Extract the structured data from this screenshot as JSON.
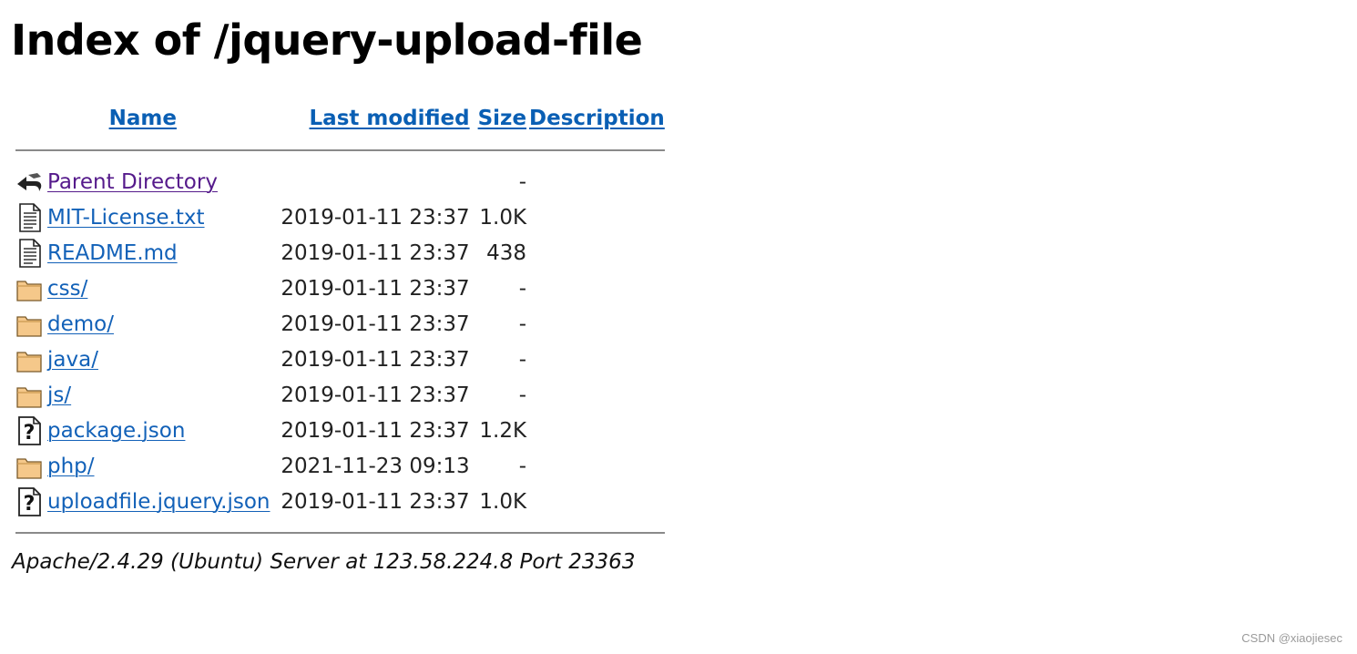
{
  "page": {
    "title": "Index of /jquery-upload-file"
  },
  "table": {
    "headers": {
      "name": "Name",
      "last_modified": "Last modified",
      "size": "Size",
      "description": "Description"
    },
    "rows": [
      {
        "icon": "back-icon",
        "name": "Parent Directory",
        "modified": "",
        "size": "-",
        "visited": true
      },
      {
        "icon": "text-file-icon",
        "name": "MIT-License.txt",
        "modified": "2019-01-11 23:37",
        "size": "1.0K"
      },
      {
        "icon": "text-file-icon",
        "name": "README.md",
        "modified": "2019-01-11 23:37",
        "size": "438"
      },
      {
        "icon": "folder-icon",
        "name": "css/",
        "modified": "2019-01-11 23:37",
        "size": "-"
      },
      {
        "icon": "folder-icon",
        "name": "demo/",
        "modified": "2019-01-11 23:37",
        "size": "-"
      },
      {
        "icon": "folder-icon",
        "name": "java/",
        "modified": "2019-01-11 23:37",
        "size": "-"
      },
      {
        "icon": "folder-icon",
        "name": "js/",
        "modified": "2019-01-11 23:37",
        "size": "-"
      },
      {
        "icon": "unknown-file-icon",
        "name": "package.json",
        "modified": "2019-01-11 23:37",
        "size": "1.2K"
      },
      {
        "icon": "folder-icon",
        "name": "php/",
        "modified": "2021-11-23 09:13",
        "size": "-"
      },
      {
        "icon": "unknown-file-icon",
        "name": "uploadfile.jquery.json",
        "modified": "2019-01-11 23:37",
        "size": "1.0K"
      }
    ]
  },
  "footer": {
    "server_signature": "Apache/2.4.29 (Ubuntu) Server at 123.58.224.8 Port 23363"
  },
  "watermark": "CSDN @xiaojiesec",
  "colors": {
    "link": "#1261b8",
    "visited_link": "#551a8b",
    "folder": "#f5c88a"
  }
}
